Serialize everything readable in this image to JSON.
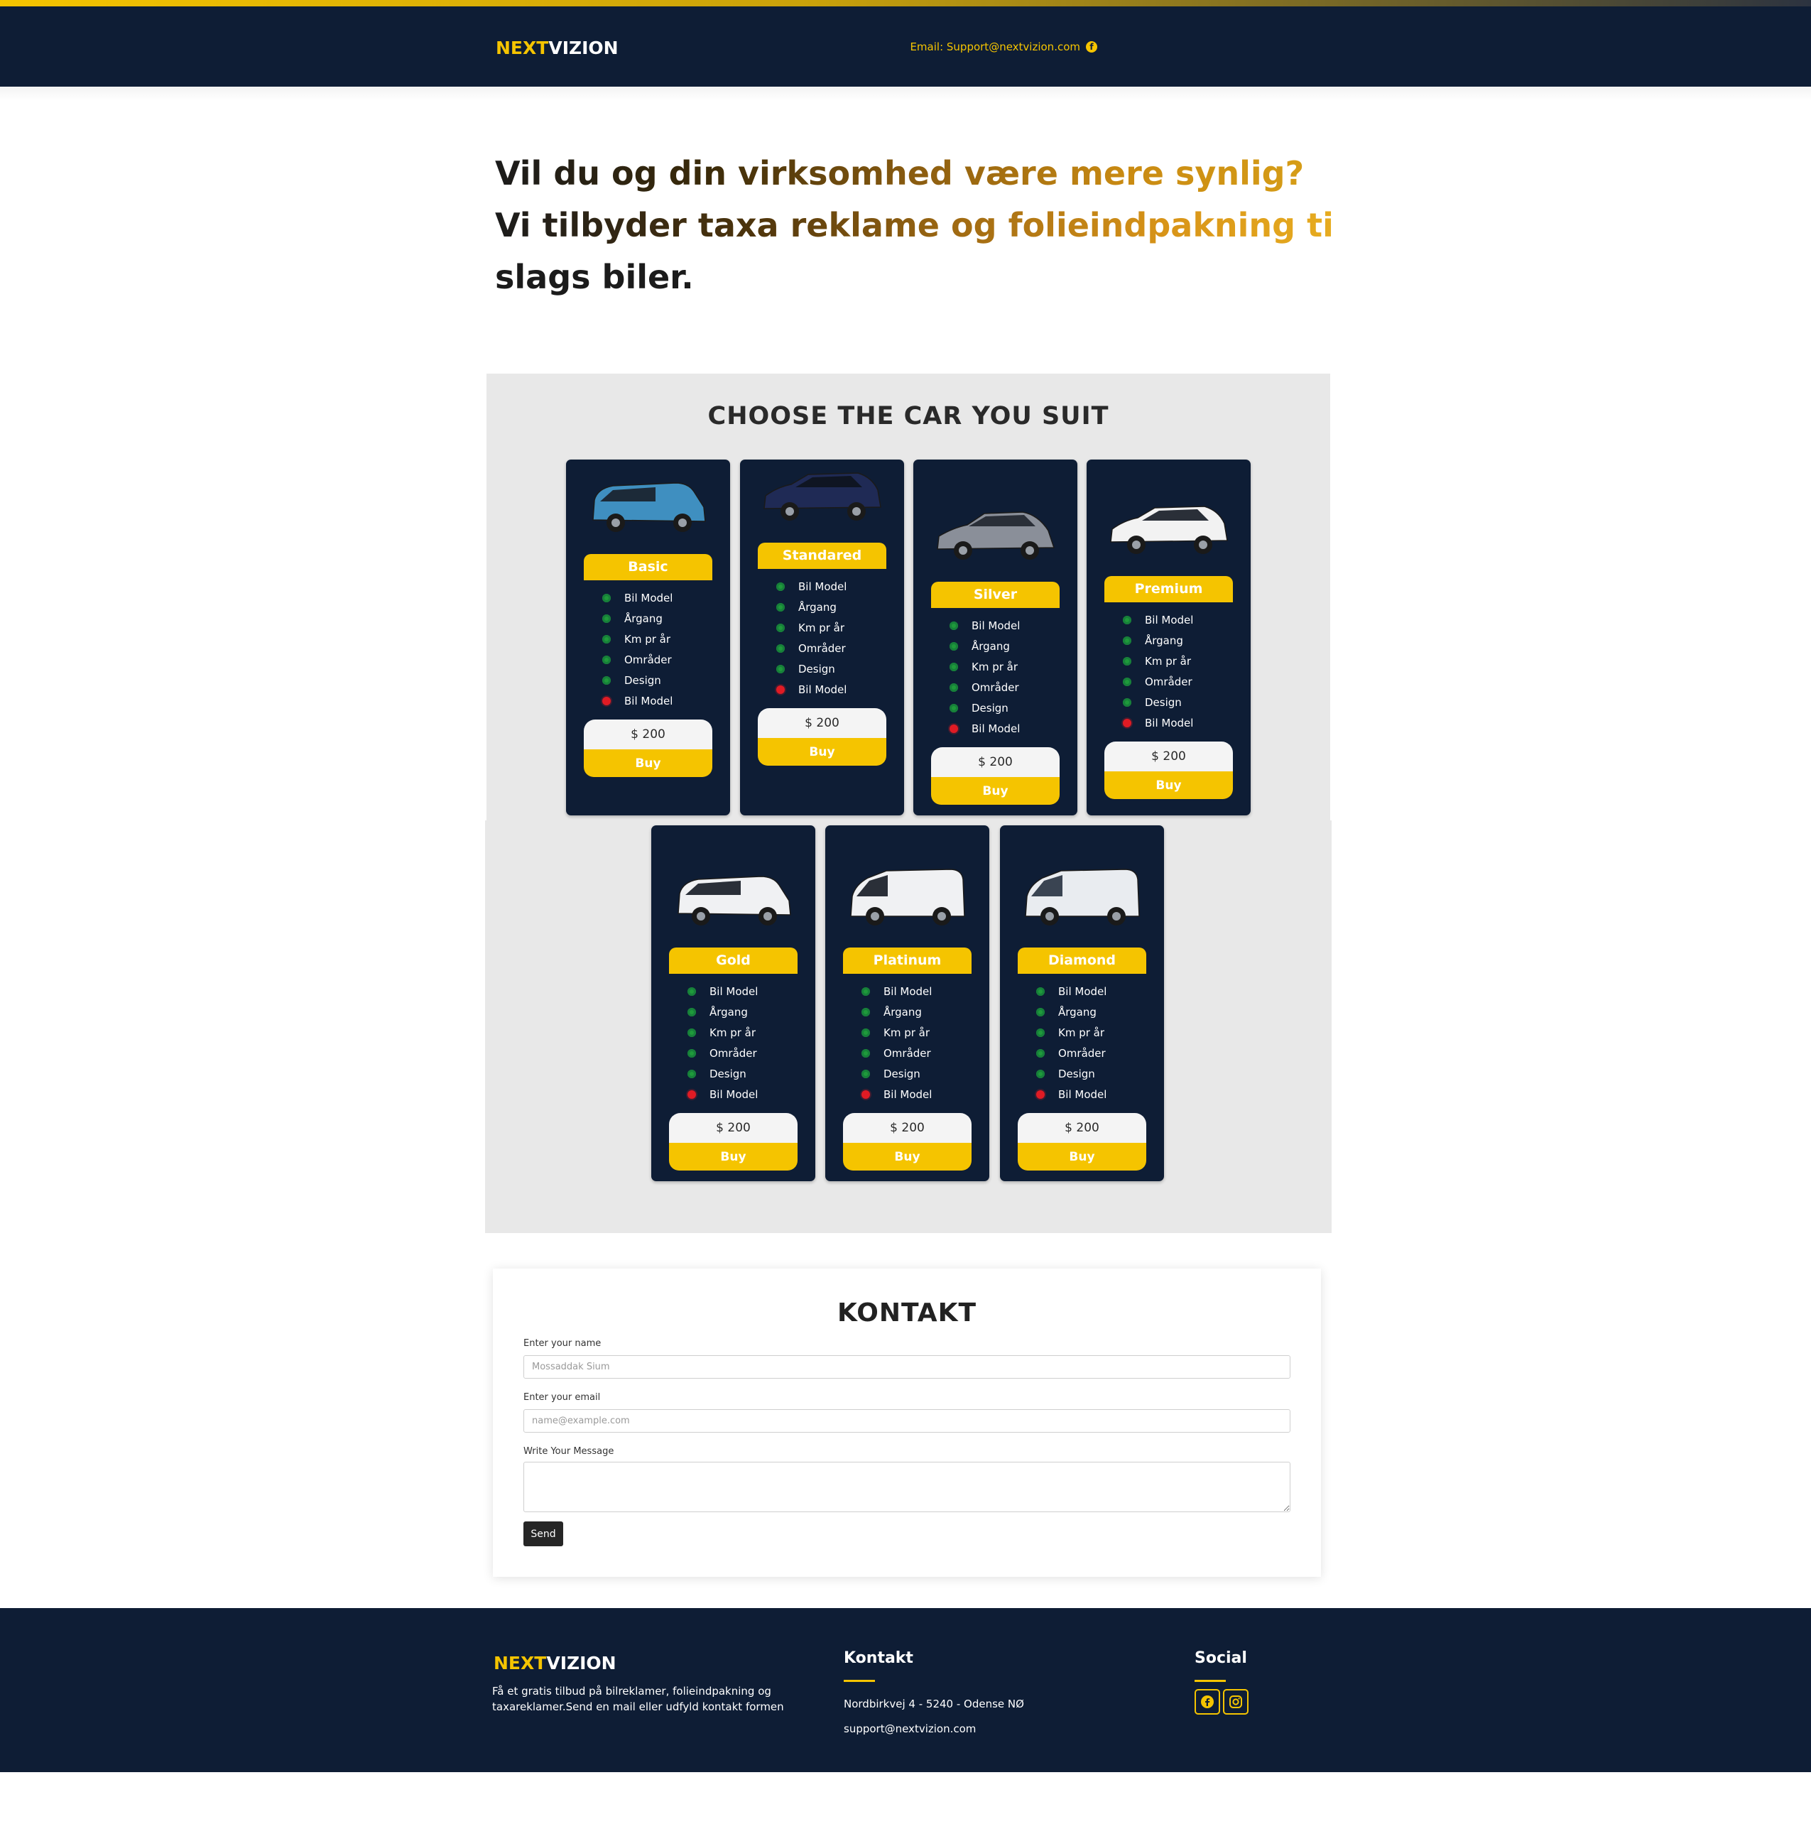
{
  "header": {
    "logo_part1": "NEXT",
    "logo_part2": "VIZION",
    "email_text": "Email: Support@nextvizion.com",
    "facebook_icon": "facebook-icon"
  },
  "hero": {
    "line1": "Vil du og din virksomhed være mere synlig?",
    "line2": "Vi tilbyder taxa reklame og folieindpakning til alle",
    "line3": "slags biler."
  },
  "pricing": {
    "title": "CHOOSE THE CAR YOU SUIT",
    "plans": [
      {
        "name": "Basic",
        "car_icon": "blue-van-icon",
        "price": "$ 200",
        "buy": "Buy",
        "features": [
          {
            "text": "Bil Model",
            "ok": true
          },
          {
            "text": "Årgang",
            "ok": true
          },
          {
            "text": "Km pr år",
            "ok": true
          },
          {
            "text": "Områder",
            "ok": true
          },
          {
            "text": "Design",
            "ok": true
          },
          {
            "text": "Bil Model",
            "ok": false
          }
        ]
      },
      {
        "name": "Standared",
        "car_icon": "dark-wagon-icon",
        "price": "$ 200",
        "buy": "Buy",
        "features": [
          {
            "text": "Bil Model",
            "ok": true
          },
          {
            "text": "Årgang",
            "ok": true
          },
          {
            "text": "Km pr år",
            "ok": true
          },
          {
            "text": "Områder",
            "ok": true
          },
          {
            "text": "Design",
            "ok": true
          },
          {
            "text": "Bil Model",
            "ok": false
          }
        ]
      },
      {
        "name": "Silver",
        "car_icon": "grey-sedan-icon",
        "price": "$ 200",
        "buy": "Buy",
        "features": [
          {
            "text": "Bil Model",
            "ok": true
          },
          {
            "text": "Årgang",
            "ok": true
          },
          {
            "text": "Km pr år",
            "ok": true
          },
          {
            "text": "Områder",
            "ok": true
          },
          {
            "text": "Design",
            "ok": true
          },
          {
            "text": "Bil Model",
            "ok": false
          }
        ]
      },
      {
        "name": "Premium",
        "car_icon": "white-wagon-icon",
        "price": "$ 200",
        "buy": "Buy",
        "features": [
          {
            "text": "Bil Model",
            "ok": true
          },
          {
            "text": "Årgang",
            "ok": true
          },
          {
            "text": "Km pr år",
            "ok": true
          },
          {
            "text": "Områder",
            "ok": true
          },
          {
            "text": "Design",
            "ok": true
          },
          {
            "text": "Bil Model",
            "ok": false
          }
        ]
      },
      {
        "name": "Gold",
        "car_icon": "white-van-icon",
        "price": "$ 200",
        "buy": "Buy",
        "features": [
          {
            "text": "Bil Model",
            "ok": true
          },
          {
            "text": "Årgang",
            "ok": true
          },
          {
            "text": "Km pr år",
            "ok": true
          },
          {
            "text": "Områder",
            "ok": true
          },
          {
            "text": "Design",
            "ok": true
          },
          {
            "text": "Bil Model",
            "ok": false
          }
        ]
      },
      {
        "name": "Platinum",
        "car_icon": "white-cargo-van-icon",
        "price": "$ 200",
        "buy": "Buy",
        "features": [
          {
            "text": "Bil Model",
            "ok": true
          },
          {
            "text": "Årgang",
            "ok": true
          },
          {
            "text": "Km pr år",
            "ok": true
          },
          {
            "text": "Områder",
            "ok": true
          },
          {
            "text": "Design",
            "ok": true
          },
          {
            "text": "Bil Model",
            "ok": false
          }
        ]
      },
      {
        "name": "Diamond",
        "car_icon": "white-minibus-icon",
        "price": "$ 200",
        "buy": "Buy",
        "features": [
          {
            "text": "Bil Model",
            "ok": true
          },
          {
            "text": "Årgang",
            "ok": true
          },
          {
            "text": "Km pr år",
            "ok": true
          },
          {
            "text": "Områder",
            "ok": true
          },
          {
            "text": "Design",
            "ok": true
          },
          {
            "text": "Bil Model",
            "ok": false
          }
        ]
      }
    ]
  },
  "contact": {
    "title": "KONTAKT",
    "name_label": "Enter your name",
    "name_placeholder": "Mossaddak Sium",
    "email_label": "Enter your email",
    "email_placeholder": "name@example.com",
    "message_label": "Write Your Message",
    "send_label": "Send"
  },
  "footer": {
    "logo_part1": "NEXT",
    "logo_part2": "VIZION",
    "description": "Få et gratis tilbud på bilreklamer, folieindpakning og taxareklamer.Send en mail eller udfyld kontakt formen",
    "contact_title": "Kontakt",
    "address": "Nordbirkvej 4 - 5240 - Odense NØ",
    "email": "support@nextvizion.com",
    "social_title": "Social",
    "social_icons": [
      "facebook-icon",
      "instagram-icon"
    ]
  },
  "colors": {
    "navy": "#0e1d35",
    "accent_yellow": "#f5c400",
    "check_green": "#1f9a3b",
    "cross_red": "#e01b24",
    "section_grey": "#e8e8e8"
  }
}
